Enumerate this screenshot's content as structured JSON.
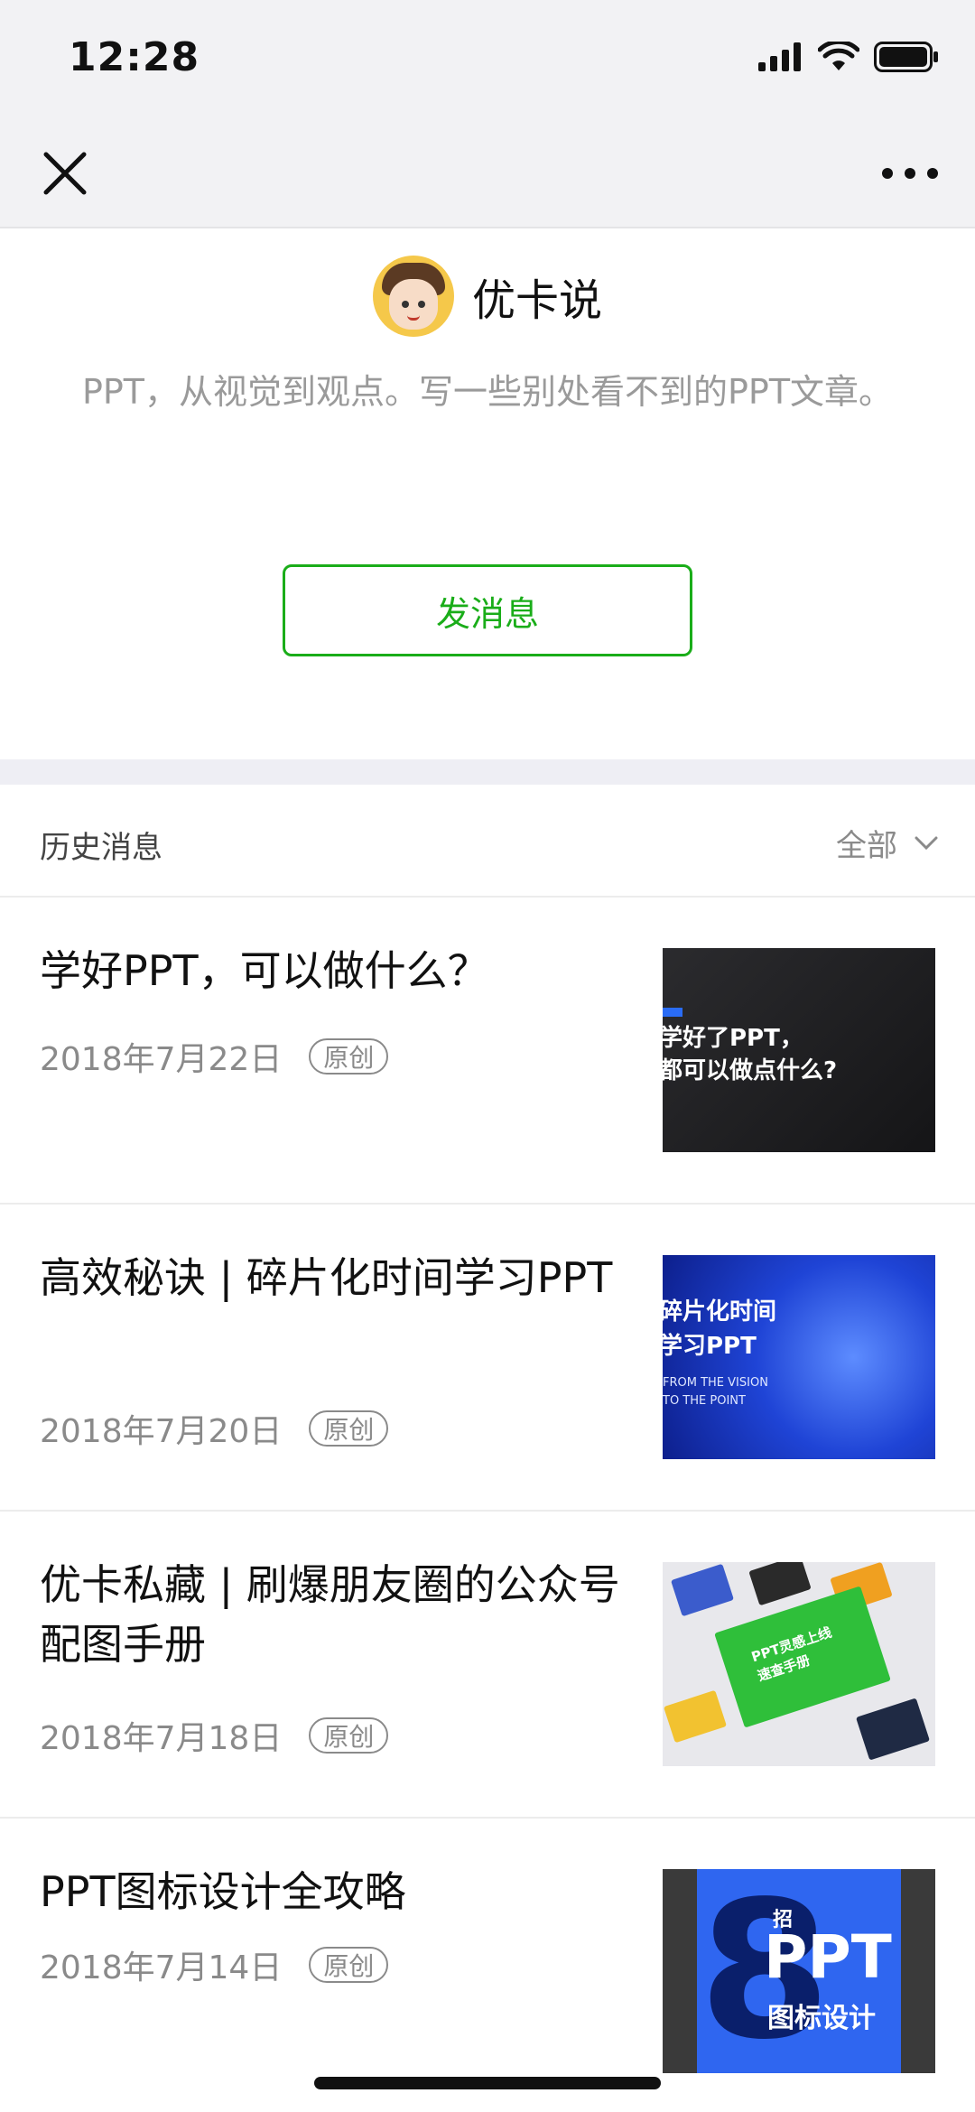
{
  "status_bar": {
    "time": "12:28"
  },
  "nav": {
    "close_icon": "close-icon",
    "more_icon": "more-dots-icon"
  },
  "profile": {
    "name": "优卡说",
    "description": "PPT，从视觉到观点。写一些别处看不到的PPT文章。",
    "message_button": "发消息"
  },
  "history": {
    "title": "历史消息",
    "filter_label": "全部"
  },
  "articles": [
    {
      "title": "学好PPT，可以做什么？",
      "date": "2018年7月22日",
      "badge": "原创",
      "thumb_text": "学好了PPT，\n都可以做点什么?"
    },
    {
      "title": "高效秘诀 | 碎片化时间学习PPT",
      "date": "2018年7月20日",
      "badge": "原创",
      "thumb_text": "碎片化时间\n学习PPT",
      "thumb_sub": "FROM THE VISION\nTO THE POINT"
    },
    {
      "title": "优卡私藏 | 刷爆朋友圈的公众号配图手册",
      "date": "2018年7月18日",
      "badge": "原创",
      "thumb_text": "PPT灵感上线\n速查手册"
    },
    {
      "title": "PPT图标设计全攻略",
      "date": "2018年7月14日",
      "badge": "原创",
      "thumb_text_small": "招",
      "thumb_text": "PPT",
      "thumb_text_2": "图标设计"
    }
  ],
  "colors": {
    "accent_green": "#1aad19",
    "background_gray": "#f2f2f4"
  }
}
